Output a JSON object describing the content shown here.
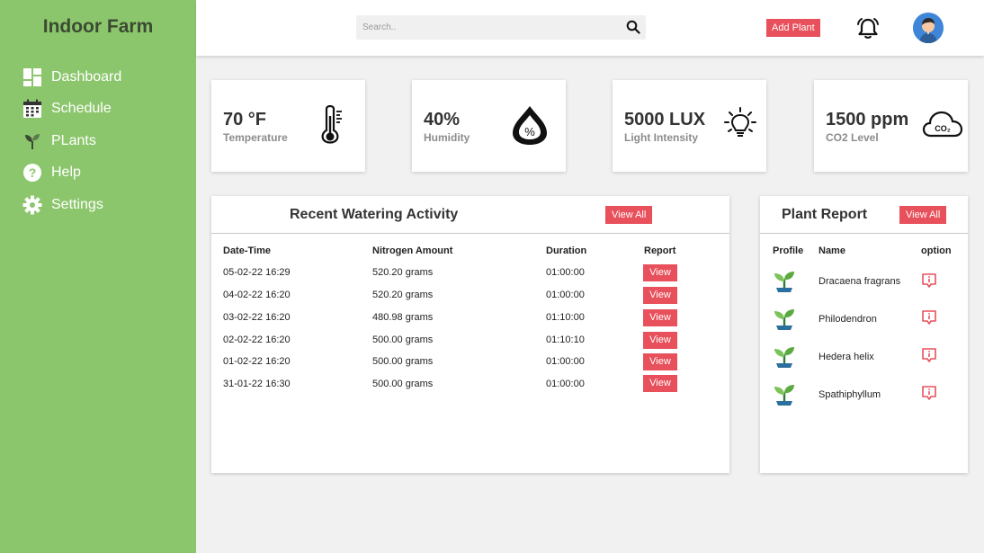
{
  "sidebar": {
    "brand": "Indoor Farm",
    "items": [
      {
        "label": "Dashboard",
        "icon": "dashboard-icon"
      },
      {
        "label": "Schedule",
        "icon": "calendar-icon"
      },
      {
        "label": "PLants",
        "icon": "sprout-icon"
      },
      {
        "label": "Help",
        "icon": "help-icon"
      },
      {
        "label": "Settings",
        "icon": "gear-icon"
      }
    ]
  },
  "header": {
    "search_placeholder": "Search..",
    "search_value": "",
    "add_plant_label": "Add Plant",
    "icons": [
      "search-icon",
      "bell-icon",
      "avatar"
    ]
  },
  "stats": [
    {
      "value": "70 °F",
      "label": "Temperature",
      "icon": "thermometer-icon"
    },
    {
      "value": "40%",
      "label": "Humidity",
      "icon": "humidity-drop-icon"
    },
    {
      "value": "5000 LUX",
      "label": "Light Intensity",
      "icon": "lightbulb-icon"
    },
    {
      "value": "1500 ppm",
      "label": "CO2 Level",
      "icon": "co2-cloud-icon"
    }
  ],
  "watering": {
    "title": "Recent Watering Activity",
    "view_all_label": "View All",
    "columns": [
      "Date-Time",
      "Nitrogen Amount",
      "Duration",
      "Report"
    ],
    "rows": [
      {
        "datetime": "05-02-22 16:29",
        "amount": "520.20 grams",
        "duration": "01:00:00",
        "report": "View"
      },
      {
        "datetime": "04-02-22 16:20",
        "amount": "520.20 grams",
        "duration": "01:00:00",
        "report": "View"
      },
      {
        "datetime": "03-02-22 16:20",
        "amount": "480.98 grams",
        "duration": "01:10:00",
        "report": "View"
      },
      {
        "datetime": "02-02-22 16:20",
        "amount": "500.00 grams",
        "duration": "01:10:10",
        "report": "View"
      },
      {
        "datetime": "01-02-22 16:20",
        "amount": "500.00 grams",
        "duration": "01:00:00",
        "report": "View"
      },
      {
        "datetime": "31-01-22 16:30",
        "amount": "500.00 grams",
        "duration": "01:00:00",
        "report": "View"
      }
    ]
  },
  "plant_report": {
    "title": "Plant Report",
    "view_all_label": "View All",
    "columns": [
      "Profile",
      "Name",
      "option"
    ],
    "plants": [
      {
        "name": "Dracaena fragrans",
        "icon": "plant-icon",
        "option_icon": "info-bubble-icon"
      },
      {
        "name": "Philodendron",
        "icon": "plant-icon",
        "option_icon": "info-bubble-icon"
      },
      {
        "name": "Hedera helix",
        "icon": "plant-icon",
        "option_icon": "info-bubble-icon"
      },
      {
        "name": "Spathiphyllum",
        "icon": "plant-icon",
        "option_icon": "info-bubble-icon"
      }
    ]
  },
  "colors": {
    "sidebar_bg": "#8cc66c",
    "accent_button": "#e8505b",
    "page_bg": "#f1f1f1",
    "avatar_bg": "#3f86d8"
  }
}
